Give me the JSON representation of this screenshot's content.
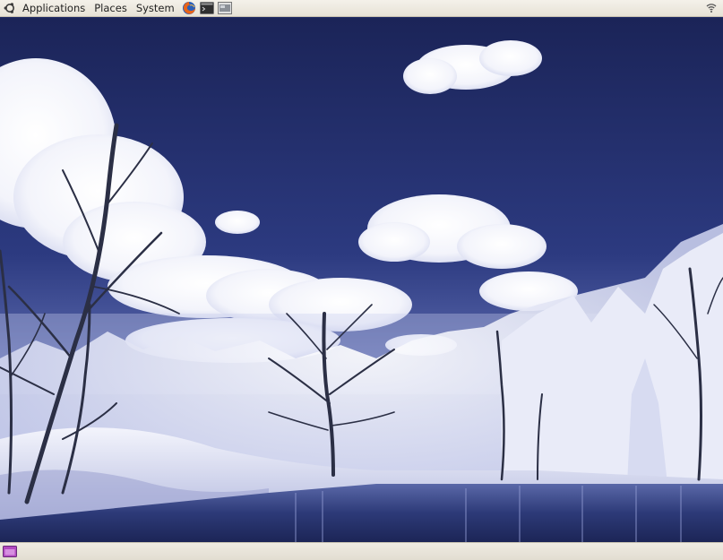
{
  "top_panel": {
    "menus": [
      {
        "label": "Applications"
      },
      {
        "label": "Places"
      },
      {
        "label": "System"
      }
    ],
    "launchers": [
      "firefox-icon",
      "terminal-icon",
      "screenshot-icon"
    ],
    "tray": [
      "network-wireless-icon"
    ]
  },
  "desktop": {
    "wallpaper": "infrared-winter-lake-landscape",
    "colors": {
      "sky_top": "#1d2760",
      "sky_mid": "#3a4a8e",
      "water": "#2d3a78",
      "snow": "#eef0fb"
    }
  },
  "bottom_panel": {
    "items": [
      "show-desktop-icon"
    ]
  }
}
